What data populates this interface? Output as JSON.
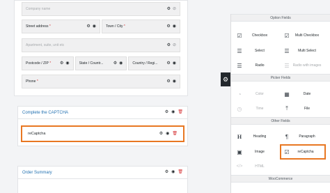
{
  "form": {
    "company": {
      "placeholder": "Company name"
    },
    "street": {
      "label": "Street address",
      "req": "*"
    },
    "town": {
      "label": "Town / City",
      "req": "*"
    },
    "apartment": {
      "placeholder": "Apartment, suite, unit etc"
    },
    "postcode": {
      "label": "Postcode / ZIP",
      "req": "*"
    },
    "state": {
      "label": "State / Countr..."
    },
    "country": {
      "label": "Country / Regi..."
    },
    "phone": {
      "label": "Phone",
      "req": "*"
    }
  },
  "captcha_section": {
    "title": "Complete the CAPTCHA",
    "field_label": "reCaptcha"
  },
  "order_section": {
    "title": "Order Summary"
  },
  "toolbar": {
    "option_fields": {
      "title": "Option Fields",
      "items": [
        {
          "label": "Checkbox",
          "icon": "☑"
        },
        {
          "label": "Multi Checkbox",
          "icon": "☑"
        },
        {
          "label": "Select",
          "icon": "☰"
        },
        {
          "label": "Multi Select",
          "icon": "☰"
        },
        {
          "label": "Radio",
          "icon": "☰"
        },
        {
          "label": "Radio with images",
          "icon": "☰"
        }
      ]
    },
    "picker_fields": {
      "title": "Picker Fields",
      "items": [
        {
          "label": "Color",
          "icon": "◔"
        },
        {
          "label": "Date",
          "icon": "▦"
        },
        {
          "label": "Time",
          "icon": "◷"
        },
        {
          "label": "File",
          "icon": "⤒"
        }
      ]
    },
    "other_fields": {
      "title": "Other Fields",
      "items": [
        {
          "label": "Heading",
          "icon": "H"
        },
        {
          "label": "Paragraph",
          "icon": "¶"
        },
        {
          "label": "Image",
          "icon": "▣"
        },
        {
          "label": "reCaptcha",
          "icon": "☑"
        },
        {
          "label": "HTML",
          "icon": "</>"
        }
      ]
    },
    "woocommerce": {
      "title": "WooCommerce"
    }
  },
  "colors": {
    "highlight": "#e87722",
    "accent": "#2271b1",
    "danger": "#d63638"
  }
}
